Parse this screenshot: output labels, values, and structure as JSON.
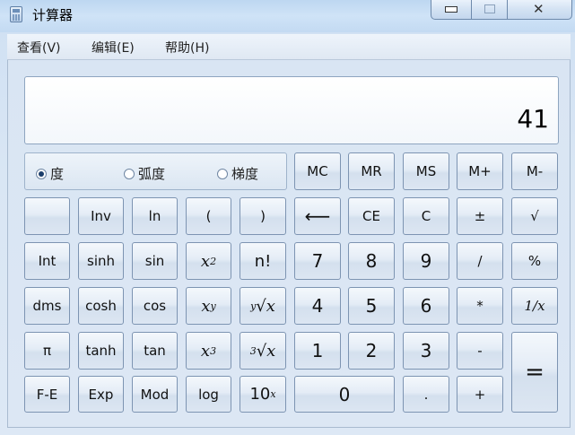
{
  "window": {
    "title": "计算器"
  },
  "menu": [
    "查看(V)",
    "编辑(E)",
    "帮助(H)"
  ],
  "display": {
    "value": "41"
  },
  "angle_modes": [
    {
      "label": "度",
      "checked": true
    },
    {
      "label": "弧度",
      "checked": false
    },
    {
      "label": "梯度",
      "checked": false
    }
  ],
  "memory_keys": [
    "MC",
    "MR",
    "MS",
    "M+",
    "M-"
  ],
  "keys": {
    "inv": "Inv",
    "ln": "ln",
    "lparen": "(",
    "rparen": ")",
    "backspace": "⟵",
    "ce": "CE",
    "c": "C",
    "plusminus": "±",
    "sqrt": "√",
    "int": "Int",
    "sinh": "sinh",
    "sin": "sin",
    "x2_base": "x",
    "x2_exp": "2",
    "fact": "n!",
    "k7": "7",
    "k8": "8",
    "k9": "9",
    "divide": "/",
    "percent": "%",
    "dms": "dms",
    "cosh": "cosh",
    "cos": "cos",
    "xy_base": "x",
    "xy_exp": "y",
    "yroot_index": "y",
    "yroot_body": "√x",
    "k4": "4",
    "k5": "5",
    "k6": "6",
    "multiply": "*",
    "reciprocal": "1/x",
    "pi": "π",
    "tanh": "tanh",
    "tan": "tan",
    "x3_base": "x",
    "x3_exp": "3",
    "cuberoot_index": "3",
    "cuberoot_body": "√x",
    "k1": "1",
    "k2": "2",
    "k3": "3",
    "minus": "-",
    "equals": "=",
    "fe": "F-E",
    "exp": "Exp",
    "mod": "Mod",
    "log": "log",
    "pow10_base": "10",
    "pow10_exp": "x",
    "k0": "0",
    "decimal": ".",
    "plus": "+"
  }
}
